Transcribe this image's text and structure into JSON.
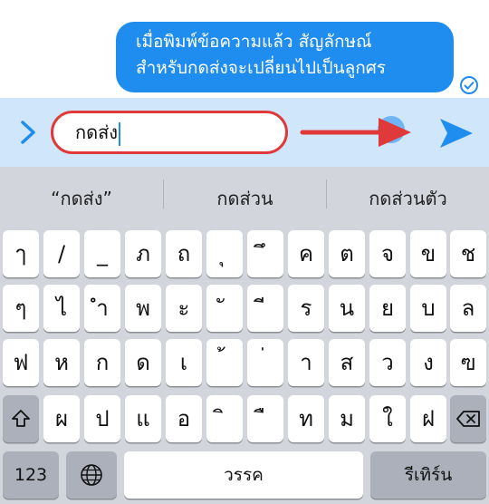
{
  "message": {
    "lines": [
      "เมื่อพิมพ์ข้อความแล้ว สัญลักษณ์",
      "สำหรับกดส่งจะเปลี่ยนไปเป็นลูกศร"
    ]
  },
  "input": {
    "value": "กดส่ง"
  },
  "suggestions": [
    "“กดส่ง”",
    "กดส่วน",
    "กดส่วนตัว"
  ],
  "keyboard": {
    "row1": [
      "ๅ",
      "/",
      "_",
      "ภ",
      "ถ",
      "ุ",
      "ึ",
      "ค",
      "ต",
      "จ",
      "ข",
      "ช"
    ],
    "row2": [
      "ๆ",
      "ไ",
      "ำ",
      "พ",
      "ะ",
      "ั",
      "ี",
      "ร",
      "น",
      "ย",
      "บ",
      "ล"
    ],
    "row3": [
      "ฟ",
      "ห",
      "ก",
      "ด",
      "เ",
      "้",
      "่",
      "า",
      "ส",
      "ว",
      "ง",
      "ฃ"
    ],
    "row4": [
      "ผ",
      "ป",
      "แ",
      "อ",
      "ิ",
      "ื",
      "ท",
      "ม",
      "ใ",
      "ฝ"
    ],
    "numbers_label": "123",
    "space_label": "วรรค",
    "return_label": "รีเทิร์น"
  },
  "colors": {
    "bubble": "#1f8cf0",
    "annotation": "#e0393a",
    "input_bar": "#d0e6fb",
    "keyboard_bg": "#d2d5db"
  }
}
